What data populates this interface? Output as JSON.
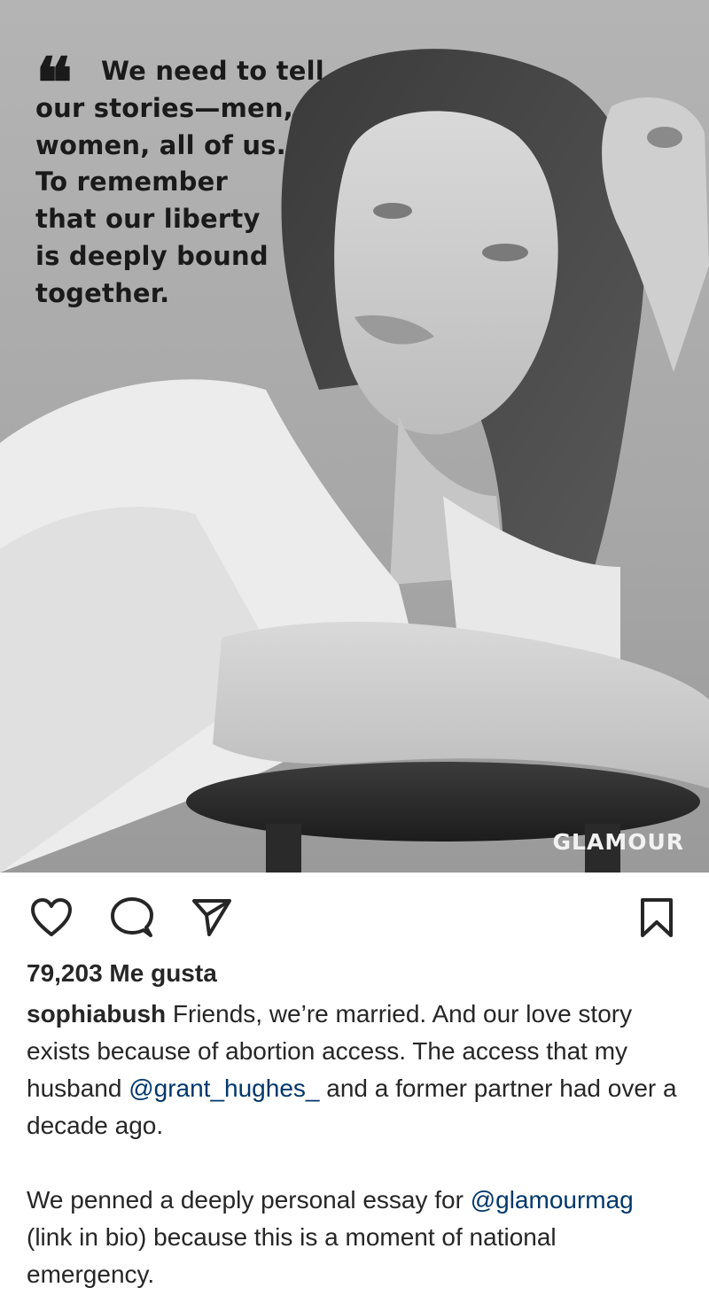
{
  "post": {
    "quote_lines": [
      "We need to tell",
      "our stories—men,",
      "women, all of us.",
      "To remember",
      "that our liberty",
      "is deeply bound",
      "together."
    ],
    "quote_mark": "❝",
    "brand": "GLAMOUR"
  },
  "actions": {
    "icons": [
      "heart-icon",
      "comment-icon",
      "paper-plane-icon",
      "bookmark-icon"
    ]
  },
  "likes": {
    "text": "79,203 Me gusta"
  },
  "caption": {
    "username": "sophiabush",
    "p1_a": " Friends, we’re married. And our love story exists because of abortion access. The access that my husband ",
    "mention_1": "@grant_hughes_",
    "p1_b": " and a former partner had over a decade ago.",
    "mention_2": "@glamourmag",
    "p2_a": "We penned a deeply personal essay for ",
    "p2_b": " (link in bio) because this is a moment of national emergency."
  },
  "colors": {
    "mention": "#00376b",
    "text": "#262626",
    "background": "#ffffff"
  }
}
